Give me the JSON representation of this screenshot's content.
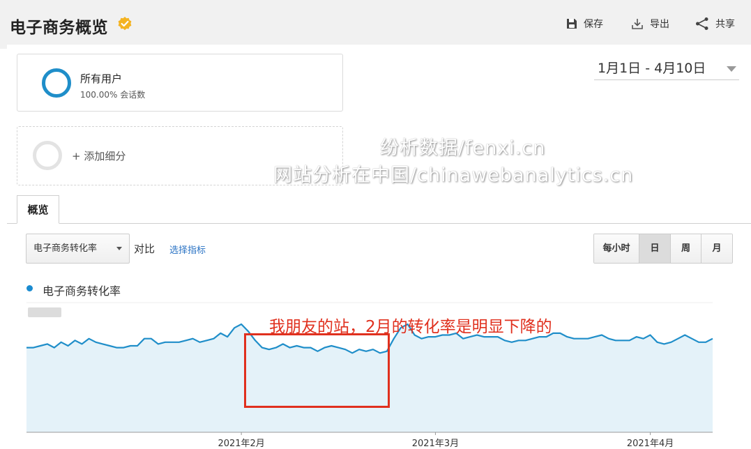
{
  "header": {
    "title": "电子商务概览",
    "tools": {
      "save_label": "保存",
      "export_label": "导出",
      "share_label": "共享"
    }
  },
  "segments": {
    "all_users": {
      "name": "所有用户",
      "share": "100.00% 会话数"
    },
    "add_label": "+ 添加细分"
  },
  "date_range": "1月1日 - 4月10日",
  "watermarks": [
    "纷析数据/fenxi.cn",
    "网站分析在中国/chinawebanalytics.cn"
  ],
  "tabs": [
    {
      "label": "概览",
      "active": true
    }
  ],
  "controls": {
    "metric_select": "电子商务转化率",
    "compare_label": "对比",
    "choose_metric_link": "选择指标",
    "granularity": [
      {
        "label": "每小时",
        "active": false
      },
      {
        "label": "日",
        "active": true
      },
      {
        "label": "周",
        "active": false
      },
      {
        "label": "月",
        "active": false
      }
    ]
  },
  "annotation": {
    "text": "我朋友的站，2月的转化率是明显下降的",
    "range_start": "2021-02-01",
    "range_end": "2021-02-20"
  },
  "colors": {
    "accent": "#1a8bd0",
    "series_line": "#1f8ec9",
    "series_fill": "#e4f2f9",
    "annotation": "#e0301e",
    "header_bg": "#f1f1f1"
  },
  "chart_data": {
    "type": "area",
    "title": "",
    "series": [
      {
        "name": "电子商务转化率",
        "x_start": "2021-01-01",
        "x_end": "2021-04-10",
        "interval": "day",
        "values": [
          0.47,
          0.47,
          0.48,
          0.49,
          0.47,
          0.5,
          0.48,
          0.51,
          0.49,
          0.52,
          0.5,
          0.49,
          0.48,
          0.47,
          0.47,
          0.48,
          0.48,
          0.52,
          0.52,
          0.49,
          0.5,
          0.5,
          0.5,
          0.51,
          0.52,
          0.5,
          0.51,
          0.52,
          0.55,
          0.53,
          0.58,
          0.6,
          0.56,
          0.51,
          0.47,
          0.46,
          0.47,
          0.49,
          0.47,
          0.48,
          0.47,
          0.47,
          0.45,
          0.47,
          0.48,
          0.47,
          0.46,
          0.44,
          0.46,
          0.45,
          0.46,
          0.44,
          0.45,
          0.52,
          0.58,
          0.6,
          0.54,
          0.52,
          0.53,
          0.53,
          0.54,
          0.54,
          0.55,
          0.52,
          0.53,
          0.54,
          0.53,
          0.53,
          0.53,
          0.51,
          0.5,
          0.51,
          0.51,
          0.52,
          0.53,
          0.53,
          0.55,
          0.55,
          0.53,
          0.52,
          0.52,
          0.52,
          0.53,
          0.54,
          0.52,
          0.51,
          0.51,
          0.51,
          0.53,
          0.52,
          0.54,
          0.5,
          0.49,
          0.5,
          0.52,
          0.54,
          0.52,
          0.5,
          0.5,
          0.52
        ]
      }
    ],
    "x_tick_labels": [
      "2021年2月",
      "2021年3月",
      "2021年4月"
    ],
    "x_tick_dates": [
      "2021-02-01",
      "2021-03-01",
      "2021-04-01"
    ],
    "y_tick_labels": [],
    "ylim": [
      0,
      0.72
    ],
    "grid": false,
    "legend": "top-left"
  }
}
